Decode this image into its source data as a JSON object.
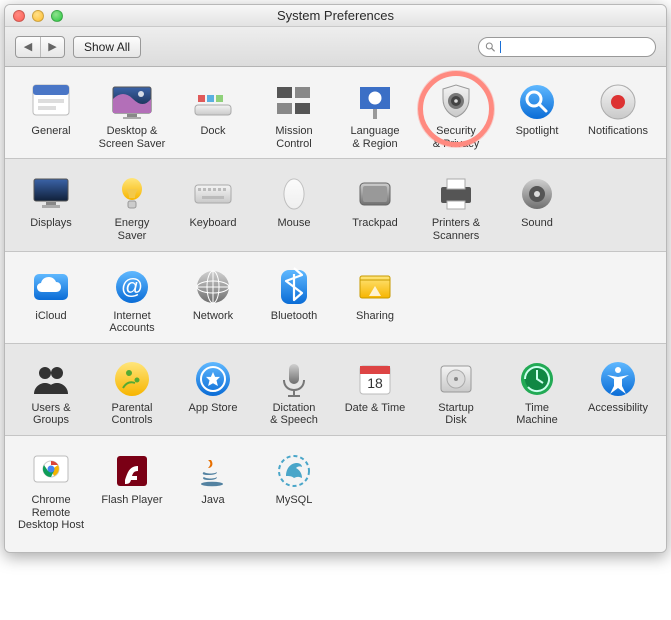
{
  "window": {
    "title": "System Preferences"
  },
  "toolbar": {
    "back_arrow": "◀",
    "fwd_arrow": "▶",
    "show_all": "Show All",
    "search_placeholder": ""
  },
  "rows": [
    [
      {
        "id": "general",
        "label": "General"
      },
      {
        "id": "desktop-screensaver",
        "label": "Desktop &\nScreen Saver"
      },
      {
        "id": "dock",
        "label": "Dock"
      },
      {
        "id": "mission-control",
        "label": "Mission\nControl"
      },
      {
        "id": "language-region",
        "label": "Language\n& Region"
      },
      {
        "id": "security-privacy",
        "label": "Security\n& Privacy",
        "highlighted": true
      },
      {
        "id": "spotlight",
        "label": "Spotlight"
      },
      {
        "id": "notifications",
        "label": "Notifications"
      }
    ],
    [
      {
        "id": "displays",
        "label": "Displays"
      },
      {
        "id": "energy-saver",
        "label": "Energy\nSaver"
      },
      {
        "id": "keyboard",
        "label": "Keyboard"
      },
      {
        "id": "mouse",
        "label": "Mouse"
      },
      {
        "id": "trackpad",
        "label": "Trackpad"
      },
      {
        "id": "printers-scanners",
        "label": "Printers &\nScanners"
      },
      {
        "id": "sound",
        "label": "Sound"
      }
    ],
    [
      {
        "id": "icloud",
        "label": "iCloud"
      },
      {
        "id": "internet-accounts",
        "label": "Internet\nAccounts"
      },
      {
        "id": "network",
        "label": "Network"
      },
      {
        "id": "bluetooth",
        "label": "Bluetooth"
      },
      {
        "id": "sharing",
        "label": "Sharing"
      }
    ],
    [
      {
        "id": "users-groups",
        "label": "Users &\nGroups"
      },
      {
        "id": "parental-controls",
        "label": "Parental\nControls"
      },
      {
        "id": "app-store",
        "label": "App Store"
      },
      {
        "id": "dictation-speech",
        "label": "Dictation\n& Speech"
      },
      {
        "id": "date-time",
        "label": "Date & Time"
      },
      {
        "id": "startup-disk",
        "label": "Startup\nDisk"
      },
      {
        "id": "time-machine",
        "label": "Time\nMachine"
      },
      {
        "id": "accessibility",
        "label": "Accessibility"
      }
    ],
    [
      {
        "id": "chrome-remote-desktop",
        "label": "Chrome Remote\nDesktop Host"
      },
      {
        "id": "flash-player",
        "label": "Flash Player"
      },
      {
        "id": "java",
        "label": "Java"
      },
      {
        "id": "mysql",
        "label": "MySQL"
      }
    ]
  ]
}
